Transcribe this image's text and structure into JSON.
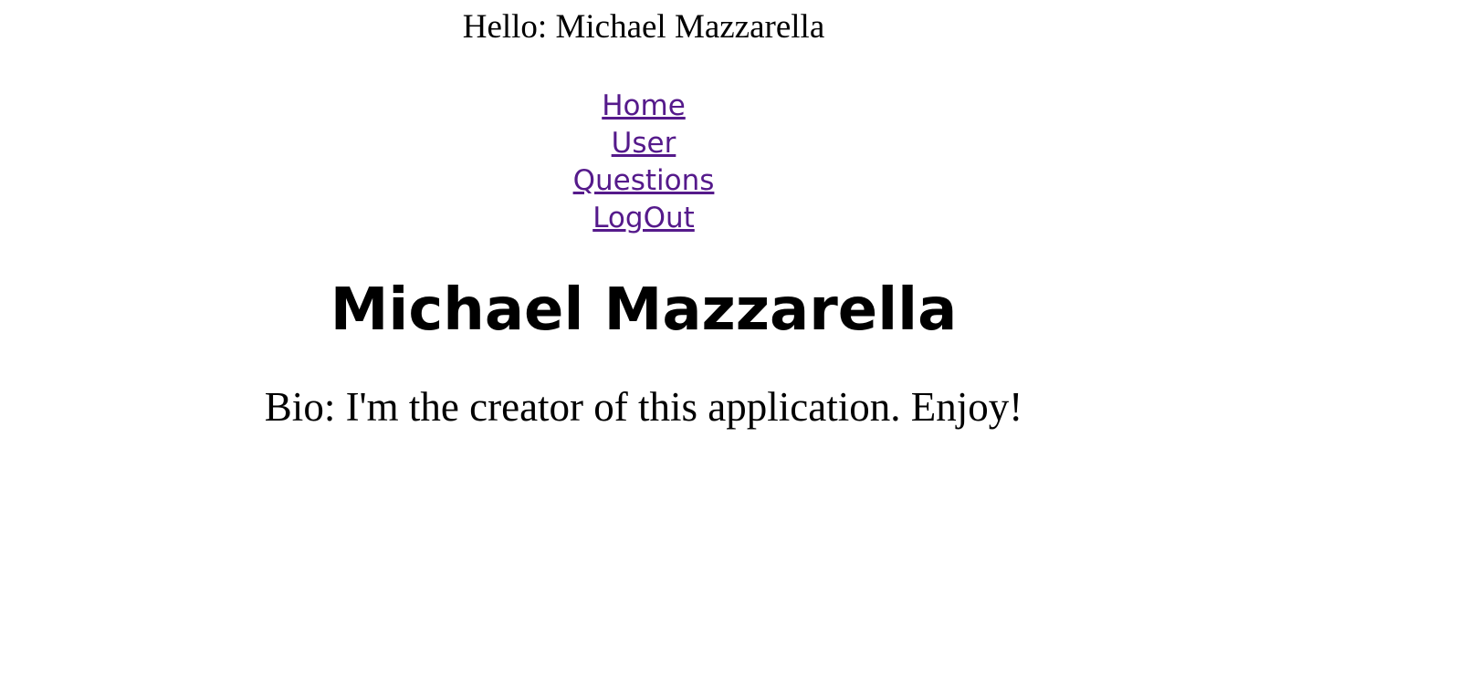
{
  "greeting": "Hello: Michael Mazzarella",
  "nav": {
    "home": "Home",
    "user": "User",
    "questions": "Questions",
    "logout": "LogOut"
  },
  "profile": {
    "name": "Michael Mazzarella",
    "bio": "Bio: I'm the creator of this application. Enjoy!"
  },
  "colors": {
    "link": "#551A8B",
    "text": "#000000"
  }
}
